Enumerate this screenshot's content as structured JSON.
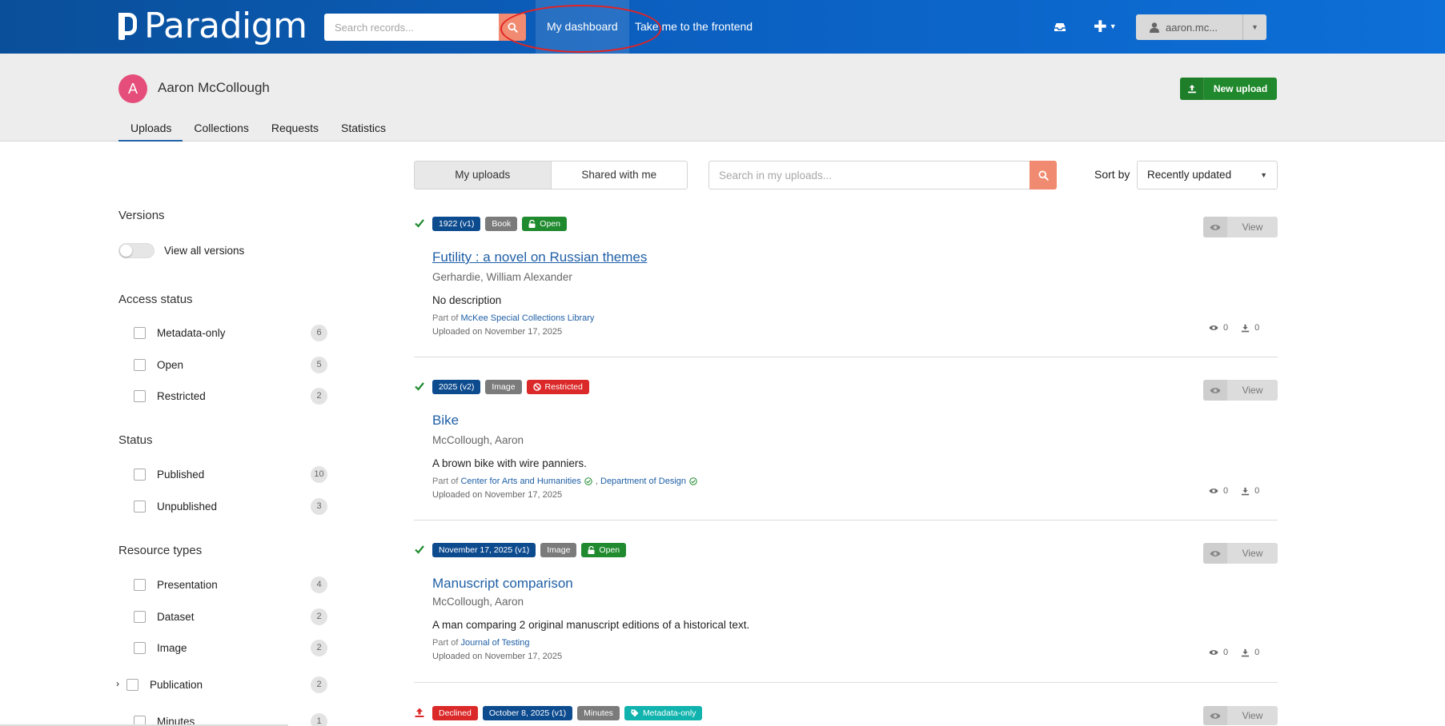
{
  "header": {
    "brand": "Paradigm",
    "search_placeholder": "Search records...",
    "nav": [
      "My dashboard",
      "Take me to the frontend"
    ],
    "user": "aaron.mc...",
    "icons": [
      "inbox-icon",
      "plus-icon",
      "user-icon",
      "search-icon"
    ]
  },
  "profile": {
    "avatar_letter": "A",
    "name": "Aaron McCollough",
    "new_upload": "New upload",
    "tabs": [
      "Uploads",
      "Collections",
      "Requests",
      "Statistics"
    ]
  },
  "sidebar": {
    "versions_title": "Versions",
    "view_all_versions": "View all versions",
    "access_title": "Access status",
    "access": [
      {
        "label": "Metadata-only",
        "count": "6"
      },
      {
        "label": "Open",
        "count": "5"
      },
      {
        "label": "Restricted",
        "count": "2"
      }
    ],
    "status_title": "Status",
    "status": [
      {
        "label": "Published",
        "count": "10"
      },
      {
        "label": "Unpublished",
        "count": "3"
      }
    ],
    "types_title": "Resource types",
    "types": [
      {
        "label": "Presentation",
        "count": "4"
      },
      {
        "label": "Dataset",
        "count": "2"
      },
      {
        "label": "Image",
        "count": "2"
      },
      {
        "label": "Publication",
        "count": "2"
      },
      {
        "label": "Minutes",
        "count": "1"
      }
    ]
  },
  "toolbar": {
    "my_uploads": "My uploads",
    "shared_with_me": "Shared with me",
    "search_placeholder": "Search in my uploads...",
    "sort_by": "Sort by",
    "sort_value": "Recently updated"
  },
  "records": [
    {
      "labels": [
        "1922 (v1)",
        "Book",
        "Open"
      ],
      "title": "Futility : a novel on Russian themes",
      "author": "Gerhardie, William Alexander",
      "description": "No description",
      "part_of_prefix": "Part of",
      "part_of": [
        "McKee Special Collections Library"
      ],
      "uploaded": "Uploaded on November 17, 2025",
      "views": "0",
      "downloads": "0",
      "view_label": "View"
    },
    {
      "labels": [
        "2025 (v2)",
        "Image",
        "Restricted"
      ],
      "title": "Bike",
      "author": "McCollough, Aaron",
      "description": "A brown bike with wire panniers.",
      "part_of_prefix": "Part of",
      "part_of": [
        "Center for Arts and Humanities",
        "Department of Design"
      ],
      "uploaded": "Uploaded on November 17, 2025",
      "views": "0",
      "downloads": "0",
      "view_label": "View"
    },
    {
      "labels": [
        "November 17, 2025 (v1)",
        "Image",
        "Open"
      ],
      "title": "Manuscript comparison",
      "author": "McCollough, Aaron",
      "description": "A man comparing 2 original manuscript editions of a historical text.",
      "part_of_prefix": "Part of",
      "part_of": [
        "Journal of Testing"
      ],
      "uploaded": "Uploaded on November 17, 2025",
      "views": "0",
      "downloads": "0",
      "view_label": "View"
    },
    {
      "labels": [
        "Declined",
        "October 8, 2025 (v1)",
        "Minutes",
        "Metadata-only"
      ],
      "view_label": "View"
    }
  ],
  "colors": {
    "header_start": "#0a4f99",
    "header_end": "#0d6fd8",
    "accent_search": "#f08a70",
    "primary_green": "#21892d",
    "label_blue": "#0d4b8f",
    "label_red": "#db2828",
    "label_teal": "#10b3ad",
    "link": "#1f5fa6",
    "highlight_annotation": "#e52222"
  }
}
